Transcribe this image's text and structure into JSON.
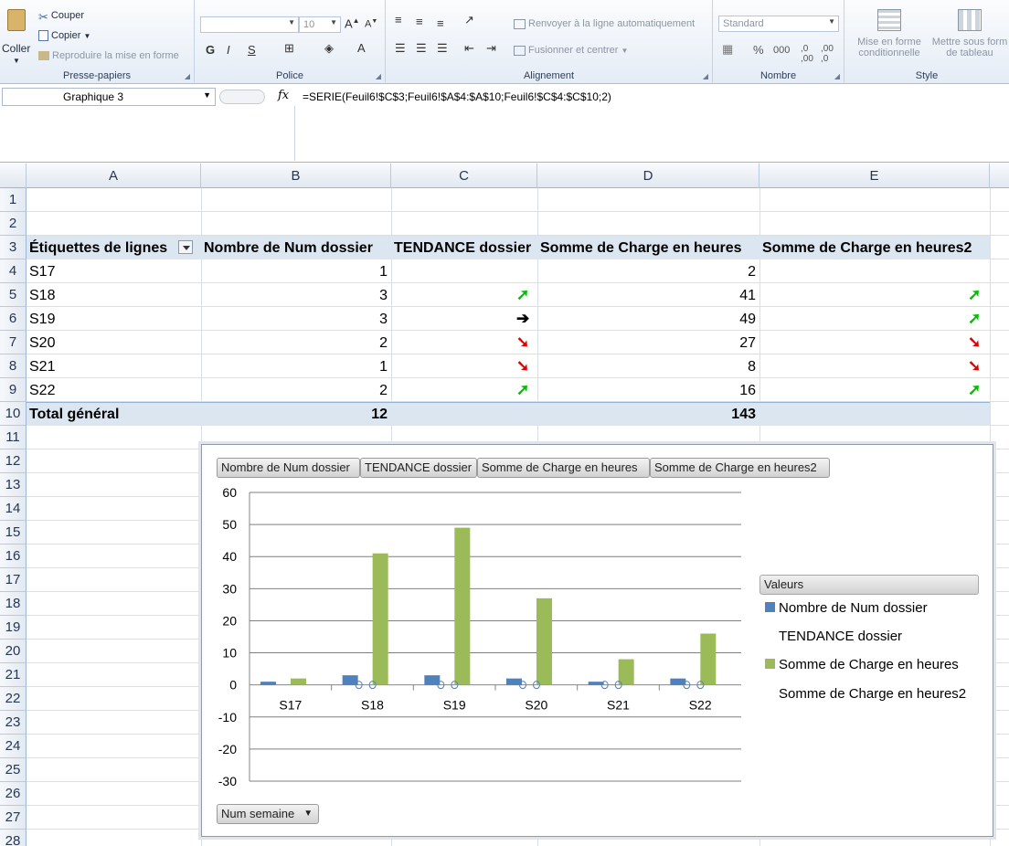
{
  "ribbon": {
    "clipboard": {
      "paste": "Coller",
      "cut": "Couper",
      "copy": "Copier",
      "format_painter": "Reproduire la mise en forme",
      "label": "Presse-papiers"
    },
    "font": {
      "font_name": "",
      "font_size": "10",
      "bold": "G",
      "italic": "I",
      "underline": "S",
      "label": "Police"
    },
    "alignment": {
      "wrap": "Renvoyer à la ligne automatiquement",
      "merge": "Fusionner et centrer",
      "label": "Alignement"
    },
    "number": {
      "format": "Standard",
      "percent": "%",
      "thousands": "000",
      "label": "Nombre"
    },
    "style": {
      "conditional_1": "Mise en forme",
      "conditional_2": "conditionnelle",
      "table_1": "Mettre sous form",
      "table_2": "de tableau",
      "label": "Style"
    }
  },
  "formula_bar": {
    "name_box": "Graphique 3",
    "fx": "fx",
    "formula": "=SERIE(Feuil6!$C$3;Feuil6!$A$4:$A$10;Feuil6!$C$4:$C$10;2)"
  },
  "columns": [
    "A",
    "B",
    "C",
    "D",
    "E"
  ],
  "rows": [
    "1",
    "2",
    "3",
    "4",
    "5",
    "6",
    "7",
    "8",
    "9",
    "10",
    "11",
    "12",
    "13",
    "14",
    "15",
    "16",
    "17",
    "18",
    "19",
    "20",
    "21",
    "22",
    "23",
    "24",
    "25",
    "26",
    "27",
    "28"
  ],
  "pivot": {
    "headers": [
      "Étiquettes de lignes",
      "Nombre de Num dossier",
      "TENDANCE dossier",
      "Somme de Charge en heures",
      "Somme de Charge en heures2"
    ],
    "rows": [
      {
        "label": "S17",
        "count": "1",
        "trend": "",
        "hours": "2",
        "trend2": ""
      },
      {
        "label": "S18",
        "count": "3",
        "trend": "up",
        "hours": "41",
        "trend2": "up"
      },
      {
        "label": "S19",
        "count": "3",
        "trend": "flat",
        "hours": "49",
        "trend2": "up"
      },
      {
        "label": "S20",
        "count": "2",
        "trend": "down",
        "hours": "27",
        "trend2": "down"
      },
      {
        "label": "S21",
        "count": "1",
        "trend": "down",
        "hours": "8",
        "trend2": "down"
      },
      {
        "label": "S22",
        "count": "2",
        "trend": "up",
        "hours": "16",
        "trend2": "up"
      }
    ],
    "total": {
      "label": "Total général",
      "count": "12",
      "hours": "143"
    }
  },
  "colors": {
    "up": "#00c000",
    "down": "#e00000",
    "flat": "#000000",
    "series1": "#4f81bd",
    "series3": "#9bbb59"
  },
  "chart_data": {
    "type": "bar",
    "categories": [
      "S17",
      "S18",
      "S19",
      "S20",
      "S21",
      "S22"
    ],
    "series": [
      {
        "name": "Nombre de Num dossier",
        "values": [
          1,
          3,
          3,
          2,
          1,
          2
        ]
      },
      {
        "name": "TENDANCE dossier",
        "values": [
          null,
          0,
          0,
          0,
          0,
          0
        ]
      },
      {
        "name": "Somme de Charge en heures",
        "values": [
          2,
          41,
          49,
          27,
          8,
          16
        ]
      },
      {
        "name": "Somme de Charge en heures2",
        "values": [
          null,
          0,
          0,
          0,
          0,
          0
        ]
      }
    ],
    "yticks": [
      "60",
      "50",
      "40",
      "30",
      "20",
      "10",
      "0",
      "-10",
      "-20",
      "-30"
    ],
    "ylim": [
      -30,
      60
    ],
    "grid": true,
    "legend_title": "Valeurs",
    "legend_position": "right",
    "field_buttons": [
      "Nombre de Num dossier",
      "TENDANCE dossier",
      "Somme de Charge en heures",
      "Somme de Charge en heures2"
    ],
    "axis_field": "Num semaine"
  }
}
